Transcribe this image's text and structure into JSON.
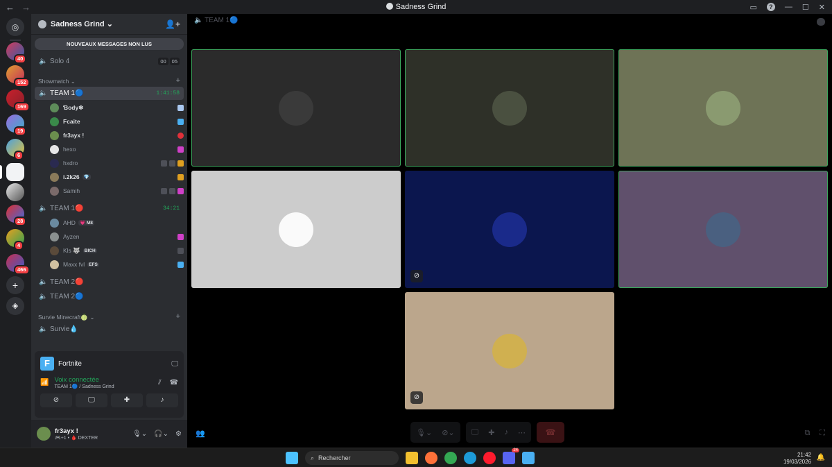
{
  "window": {
    "title": "Sadness Grind"
  },
  "guilds": {
    "badges": [
      "40",
      "152",
      "169",
      "19",
      "6",
      "28",
      "4",
      "466"
    ]
  },
  "server": {
    "name": "Sadness Grind",
    "unread_banner": "NOUVEAUX MESSAGES NON LUS",
    "channels": {
      "solo4": {
        "name": "Solo 4",
        "count_a": "00",
        "count_b": "05"
      },
      "cat_showmatch": "Showmatch",
      "team1a": {
        "name": "TEAM 1🔵",
        "timer": "1:41:58"
      },
      "team1b": {
        "name": "TEAM 1🔴",
        "timer": "34:21"
      },
      "team2a": {
        "name": "TEAM 2🔴"
      },
      "team2b": {
        "name": "TEAM 2🔵"
      },
      "cat_survie": "Survie Minecraft🍈",
      "survie": {
        "name": "Survie💧"
      }
    },
    "team1a_members": [
      {
        "name": "Ɓody❄"
      },
      {
        "name": "Fcaite"
      },
      {
        "name": "fr3ayx !"
      },
      {
        "name": "hexo"
      },
      {
        "name": "hxdro"
      },
      {
        "name": "i.2k26",
        "tag": "💎"
      },
      {
        "name": "Samih"
      }
    ],
    "team1b_members": [
      {
        "name": "AHD",
        "tag": "💗 M8"
      },
      {
        "name": "Ayzen"
      },
      {
        "name": "Kls 🐺",
        "tag": "BICH"
      },
      {
        "name": "Maxx fvl",
        "tag": "EFS"
      }
    ]
  },
  "activity": {
    "game": "Fortnite",
    "voice_status": "Voix connectée",
    "voice_location": "TEAM 1🔵 / Sadness Grind"
  },
  "user": {
    "name": "fr3ayx !",
    "status": "🎮+1 • 🩸 DEXTER"
  },
  "stage": {
    "header": "TEAM 1🔵"
  },
  "taskbar": {
    "search_placeholder": "Rechercher",
    "time": "21:42",
    "date": "19/03/2026",
    "discord_badge": "24"
  },
  "colors": {
    "speaking": "#3ba55c",
    "accent": "#5865f2",
    "danger": "#f23f43"
  },
  "tiles": [
    {
      "name": "tile-1",
      "bg": "#2b2b2b",
      "speaking": true,
      "muted": false
    },
    {
      "name": "tile-2",
      "bg": "#2e3028",
      "speaking": true,
      "muted": false
    },
    {
      "name": "tile-3",
      "bg": "#6e7356",
      "speaking": true,
      "muted": false
    },
    {
      "name": "tile-4",
      "bg": "#cccccc",
      "speaking": false,
      "muted": false
    },
    {
      "name": "tile-5",
      "bg": "#0b164e",
      "speaking": false,
      "muted": true
    },
    {
      "name": "tile-6",
      "bg": "#60506c",
      "speaking": true,
      "muted": false
    },
    {
      "name": "tile-7",
      "bg": "#bba68c",
      "speaking": false,
      "muted": true
    }
  ]
}
